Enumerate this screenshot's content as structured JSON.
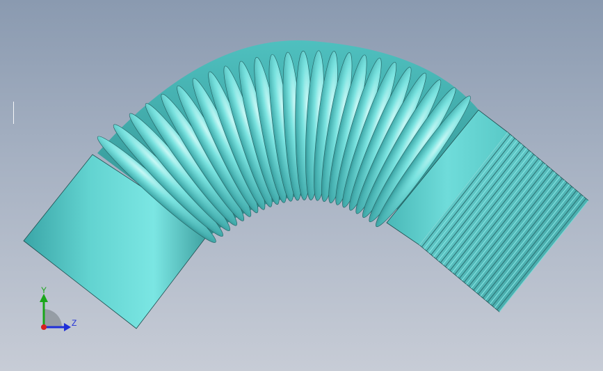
{
  "viewport": {
    "background_top": "#8a9ab0",
    "background_bottom": "#c7ccd6"
  },
  "model": {
    "name": "corrugated-bellows-hose",
    "color": "#64d6d2",
    "shade_color": "#3f9fa0",
    "highlight_color": "#b8f4f2",
    "convolution_count": 25
  },
  "triad": {
    "y_label": "Y",
    "z_label": "Z",
    "y_color": "#1aa61a",
    "z_color": "#1f2fd8",
    "x_color": "#d81f1f"
  }
}
